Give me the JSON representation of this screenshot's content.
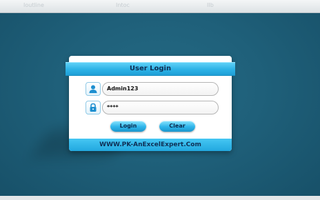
{
  "window": {
    "hints": [
      "Ioutline",
      "Intoc",
      "IIb"
    ]
  },
  "login_dialog": {
    "title": "User Login",
    "username_value": "Admin123",
    "password_value": "****",
    "login_label": "Login",
    "clear_label": "Clear",
    "footer_text": "WWW.PK-AnExcelExpert.Com"
  },
  "icons": {
    "username": "user-icon",
    "password": "lock-icon"
  },
  "colors": {
    "background": "#1e5f78",
    "accent": "#2cb2e6",
    "dialog": "#ffffff",
    "text_dark": "#0f2f55"
  }
}
